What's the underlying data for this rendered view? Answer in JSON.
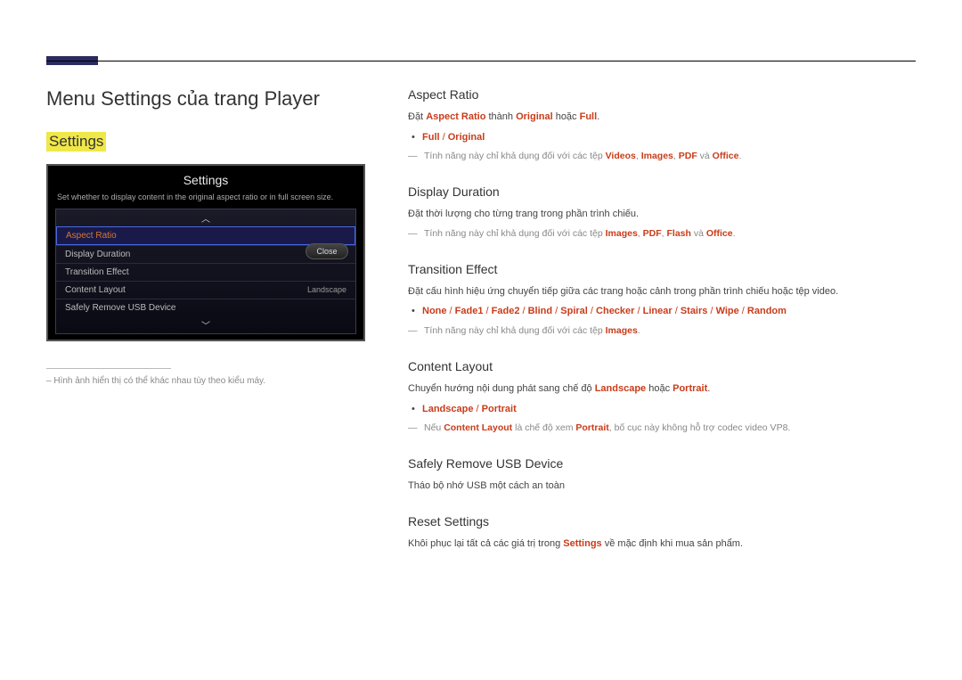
{
  "page": {
    "title": "Menu Settings của trang Player",
    "settings_heading": "Settings"
  },
  "tv": {
    "title": "Settings",
    "desc": "Set whether to display content in the original aspect ratio or in full screen size.",
    "close": "Close",
    "items": [
      {
        "label": "Aspect Ratio",
        "value": "",
        "selected": true
      },
      {
        "label": "Display Duration",
        "value": "",
        "selected": false
      },
      {
        "label": "Transition Effect",
        "value": "",
        "selected": false
      },
      {
        "label": "Content Layout",
        "value": "Landscape",
        "selected": false
      },
      {
        "label": "Safely Remove USB Device",
        "value": "",
        "selected": false
      }
    ]
  },
  "footnote": "Hình ảnh hiển thị có thể khác nhau tùy theo kiểu máy.",
  "sections": {
    "aspect": {
      "title": "Aspect Ratio",
      "line1_pre": "Đặt ",
      "line1_b1": "Aspect Ratio",
      "line1_mid": " thành ",
      "line1_b2": "Original",
      "line1_or": " hoặc ",
      "line1_b3": "Full",
      "line1_dot": ".",
      "opt1": "Full",
      "sep": " / ",
      "opt2": "Original",
      "note_pre": "Tính năng này chỉ khả dụng đối với các tệp ",
      "note_v": "Videos",
      "note_c1": ", ",
      "note_i": "Images",
      "note_c2": ", ",
      "note_p": "PDF",
      "note_and": " và ",
      "note_o": "Office",
      "note_dot": "."
    },
    "duration": {
      "title": "Display Duration",
      "desc": "Đặt thời lượng cho từng trang trong phần trình chiếu.",
      "note_pre": "Tính năng này chỉ khả dụng đối với các tệp ",
      "note_i": "Images",
      "note_c1": ", ",
      "note_p": "PDF",
      "note_c2": ", ",
      "note_f": "Flash",
      "note_and": " và ",
      "note_o": "Office",
      "note_dot": "."
    },
    "transition": {
      "title": "Transition Effect",
      "desc": "Đặt cấu hình hiệu ứng chuyển tiếp giữa các trang hoặc cảnh trong phần trình chiếu hoặc tệp video.",
      "opts": [
        "None",
        "Fade1",
        "Fade2",
        "Blind",
        "Spiral",
        "Checker",
        "Linear",
        "Stairs",
        "Wipe",
        "Random"
      ],
      "sep": " / ",
      "note_pre": "Tính năng này chỉ khả dụng đối với các tệp ",
      "note_i": "Images",
      "note_dot": "."
    },
    "layout": {
      "title": "Content Layout",
      "line1_pre": "Chuyển hướng nội dung phát sang chế độ ",
      "line1_b1": "Landscape",
      "line1_or": " hoặc ",
      "line1_b2": "Portrait",
      "line1_dot": ".",
      "opt1": "Landscape",
      "sep": " / ",
      "opt2": "Portrait",
      "note_pre": "Nếu ",
      "note_b1": "Content Layout",
      "note_mid": " là chế độ xem ",
      "note_b2": "Portrait",
      "note_post": ", bố cục này không hỗ trợ codec video VP8."
    },
    "usb": {
      "title": "Safely Remove USB Device",
      "desc": "Tháo bộ nhớ USB một cách an toàn"
    },
    "reset": {
      "title": "Reset Settings",
      "line_pre": "Khôi phục lại tất cả các giá trị trong ",
      "line_b1": "Settings",
      "line_post": " về mặc định khi mua sản phẩm."
    }
  }
}
